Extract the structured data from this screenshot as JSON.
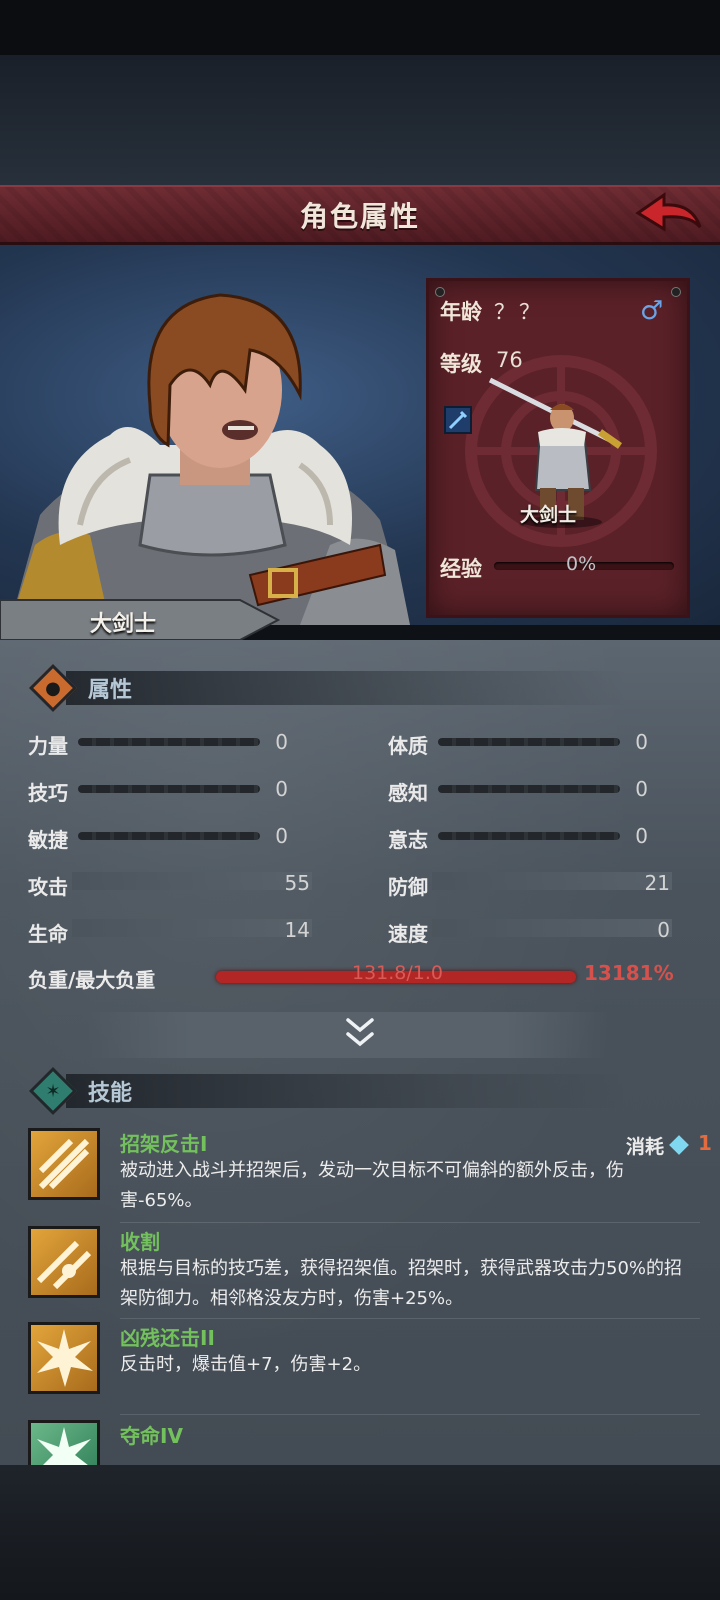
{
  "header": {
    "title": "角色属性",
    "back_icon": "back-arrow-icon"
  },
  "character": {
    "class_name": "大剑士",
    "age_label": "年龄",
    "age_value": "？？",
    "gender_symbol": "♂",
    "level_label": "等级",
    "level_value": "76",
    "class_mini_label": "大剑士",
    "exp_label": "经验",
    "exp_value": "0%"
  },
  "attributes": {
    "section_title": "属性",
    "rows": [
      {
        "label": "力量",
        "value": "0"
      },
      {
        "label": "体质",
        "value": "0"
      },
      {
        "label": "技巧",
        "value": "0"
      },
      {
        "label": "感知",
        "value": "0"
      },
      {
        "label": "敏捷",
        "value": "0"
      },
      {
        "label": "意志",
        "value": "0"
      },
      {
        "label": "攻击",
        "value": "55"
      },
      {
        "label": "防御",
        "value": "21"
      },
      {
        "label": "生命",
        "value": "14"
      },
      {
        "label": "速度",
        "value": "0"
      }
    ],
    "weight_label": "负重/最大负重",
    "weight_value": "131.8/1.0",
    "weight_percent": "13181%"
  },
  "skills": {
    "section_title": "技能",
    "cost_label": "消耗",
    "cost_value": "1",
    "items": [
      {
        "name": "招架反击I",
        "desc": "被动进入战斗并招架后，发动一次目标不可偏斜的额外反击，伤害-65%。"
      },
      {
        "name": "收割",
        "desc": "根据与目标的技巧差，获得招架值。招架时，获得武器攻击力50%的招架防御力。相邻格没友方时，伤害+25%。"
      },
      {
        "name": "凶残还击II",
        "desc": "反击时，爆击值+7，伤害+2。"
      },
      {
        "name": "夺命IV",
        "desc": ""
      }
    ]
  },
  "colors": {
    "banner": "#6f2c33",
    "skill_name": "#73c15d",
    "weight_bar": "#b32626",
    "gender": "#6aa4e6"
  }
}
